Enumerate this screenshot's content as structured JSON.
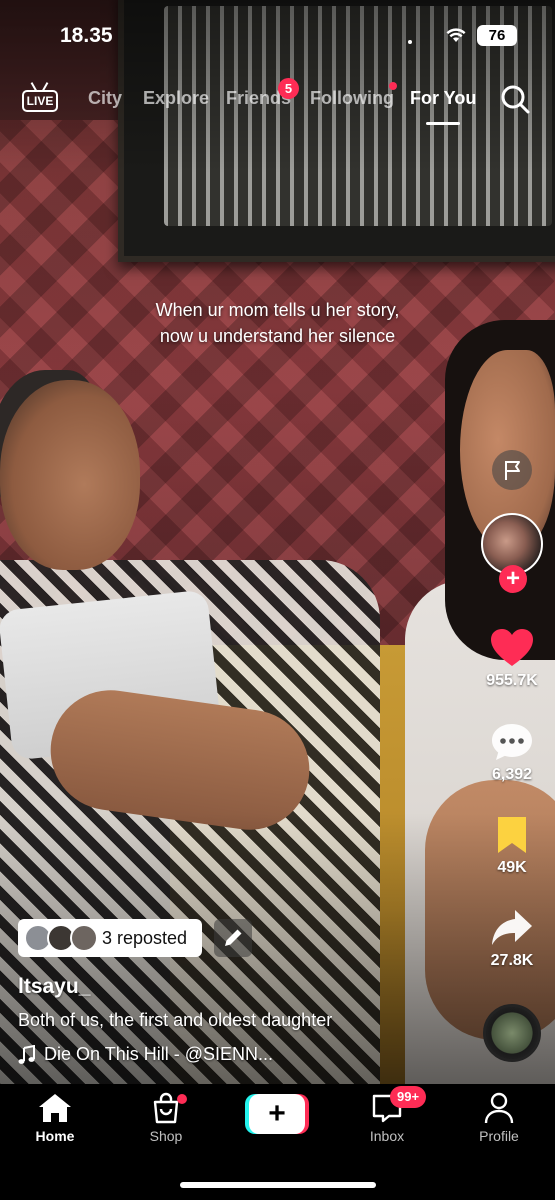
{
  "status_bar": {
    "time": "18.35",
    "battery": "76"
  },
  "top_nav": {
    "live_label": "LIVE",
    "tabs": [
      {
        "label": "City"
      },
      {
        "label": "Explore"
      },
      {
        "label": "Friends",
        "badge": "5"
      },
      {
        "label": "Following"
      },
      {
        "label": "For You",
        "active": true
      }
    ]
  },
  "video": {
    "caption": "When ur mom tells u her story, now u understand her silence"
  },
  "right_rail": {
    "likes": "955.7K",
    "comments": "6,392",
    "saves": "49K",
    "shares": "27.8K"
  },
  "post": {
    "repost_label": "3 reposted",
    "username": "ltsayu_",
    "description": "Both of us, the first and oldest daughter",
    "sound": "Die On This Hill - @SIENN..."
  },
  "tab_bar": {
    "tabs": [
      {
        "label": "Home",
        "active": true
      },
      {
        "label": "Shop"
      },
      {
        "label": ""
      },
      {
        "label": "Inbox",
        "badge": "99+"
      },
      {
        "label": "Profile"
      }
    ]
  },
  "colors": {
    "accent": "#fe2c55",
    "cyan": "#25f4ee",
    "save": "#fcd240"
  }
}
